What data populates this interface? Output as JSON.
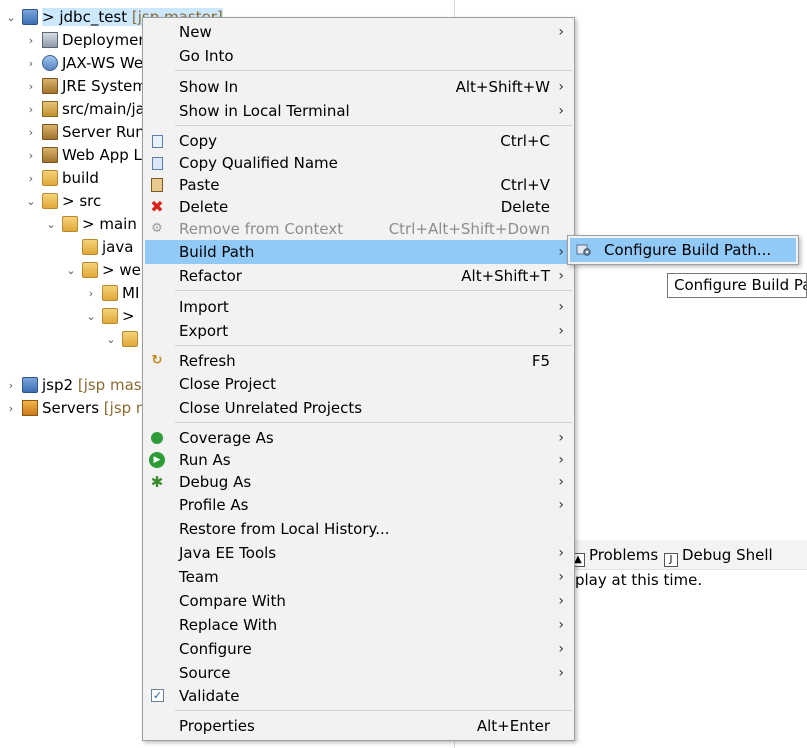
{
  "explorer": {
    "rows": [
      {
        "label": "jdbc_test",
        "prefix": ">",
        "decoration": "[jsp master]",
        "icon": "project-icon"
      },
      {
        "label": "Deploymen",
        "icon": "deployment-descriptor-icon"
      },
      {
        "label": "JAX-WS We",
        "icon": "web-services-icon"
      },
      {
        "label": "JRE System",
        "icon": "library-icon"
      },
      {
        "label": "src/main/ja",
        "icon": "source-folder-icon"
      },
      {
        "label": "Server Runt",
        "icon": "library-icon"
      },
      {
        "label": "Web App L",
        "icon": "library-icon"
      },
      {
        "label": "build",
        "icon": "folder-icon"
      },
      {
        "label": "src",
        "prefix": ">",
        "icon": "folder-icon"
      },
      {
        "label": "main",
        "prefix": ">",
        "icon": "folder-icon"
      },
      {
        "label": "java",
        "icon": "folder-icon"
      },
      {
        "label": "we",
        "prefix": ">",
        "icon": "folder-icon"
      },
      {
        "label": "MI",
        "icon": "folder-icon"
      },
      {
        "label": "",
        "prefix": ">",
        "icon": "folder-icon"
      },
      {
        "label": "",
        "icon": "folder-icon"
      },
      {
        "label": "jsp2",
        "decoration": "[jsp maste",
        "icon": "project-icon"
      },
      {
        "label": "Servers",
        "decoration": "[jsp ma",
        "icon": "folder-icon"
      }
    ]
  },
  "views": {
    "tabs": [
      {
        "label": "Problems",
        "icon": "problems-icon"
      },
      {
        "label": "Debug Shell",
        "icon": "debug-shell-icon"
      }
    ],
    "message": "isplay at this time."
  },
  "context_menu": {
    "items": [
      {
        "label": "New",
        "submenu": true
      },
      {
        "label": "Go Into"
      },
      {
        "label": "Show In",
        "accelerator": "Alt+Shift+W",
        "submenu": true
      },
      {
        "label": "Show in Local Terminal",
        "submenu": true
      },
      {
        "label": "Copy",
        "accelerator": "Ctrl+C",
        "icon": "copy-icon"
      },
      {
        "label": "Copy Qualified Name",
        "icon": "copy-qualified-name-icon"
      },
      {
        "label": "Paste",
        "accelerator": "Ctrl+V",
        "icon": "paste-icon"
      },
      {
        "label": "Delete",
        "accelerator": "Delete",
        "icon": "delete-icon"
      },
      {
        "label": "Remove from Context",
        "accelerator": "Ctrl+Alt+Shift+Down",
        "icon": "remove-context-icon",
        "disabled": true
      },
      {
        "label": "Build Path",
        "submenu": true,
        "active": true
      },
      {
        "label": "Refactor",
        "accelerator": "Alt+Shift+T",
        "submenu": true
      },
      {
        "label": "Import",
        "submenu": true
      },
      {
        "label": "Export",
        "submenu": true
      },
      {
        "label": "Refresh",
        "accelerator": "F5",
        "icon": "refresh-icon"
      },
      {
        "label": "Close Project"
      },
      {
        "label": "Close Unrelated Projects"
      },
      {
        "label": "Coverage As",
        "submenu": true,
        "icon": "coverage-icon"
      },
      {
        "label": "Run As",
        "submenu": true,
        "icon": "run-icon"
      },
      {
        "label": "Debug As",
        "submenu": true,
        "icon": "debug-icon"
      },
      {
        "label": "Profile As",
        "submenu": true
      },
      {
        "label": "Restore from Local History..."
      },
      {
        "label": "Java EE Tools",
        "submenu": true
      },
      {
        "label": "Team",
        "submenu": true
      },
      {
        "label": "Compare With",
        "submenu": true
      },
      {
        "label": "Replace With",
        "submenu": true
      },
      {
        "label": "Configure",
        "submenu": true
      },
      {
        "label": "Source",
        "submenu": true
      },
      {
        "label": "Validate",
        "icon": "validate-icon"
      },
      {
        "label": "Properties",
        "accelerator": "Alt+Enter"
      }
    ]
  },
  "submenu": {
    "label": "Configure Build Path...",
    "icon": "configure-build-path-icon"
  },
  "tooltip": {
    "text": "Configure Build Path"
  },
  "colors": {
    "menu_background": "#f2f2f2",
    "menu_highlight": "#91c9f7",
    "selection": "#cce8ff",
    "disabled_text": "#8d8d8d"
  }
}
